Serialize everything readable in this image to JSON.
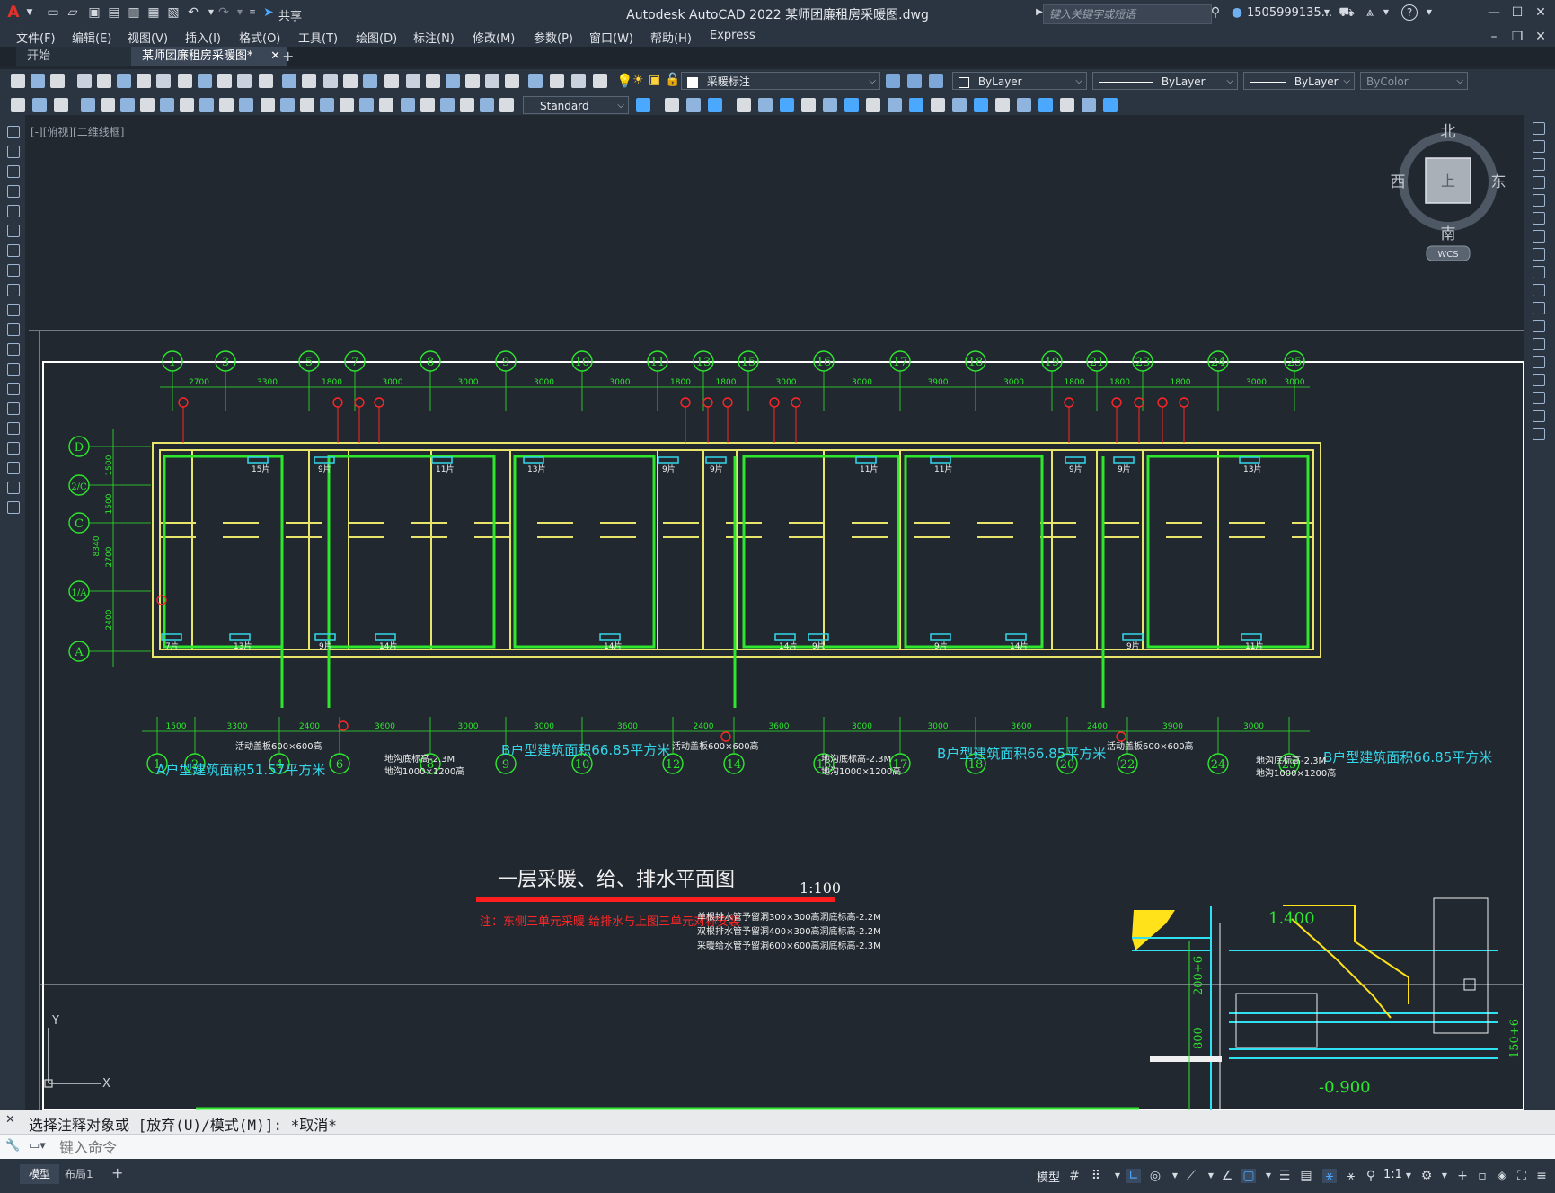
{
  "app": {
    "title": "Autodesk AutoCAD 2022    某师团廉租房采暖图.dwg",
    "logo": "A",
    "share_label": "共享",
    "search_placeholder": "键入关键字或短语",
    "user": "1505999135...",
    "help_icon": "?"
  },
  "menubar": [
    "文件(F)",
    "编辑(E)",
    "视图(V)",
    "插入(I)",
    "格式(O)",
    "工具(T)",
    "绘图(D)",
    "标注(N)",
    "修改(M)",
    "参数(P)",
    "窗口(W)",
    "帮助(H)",
    "Express"
  ],
  "tabs": [
    {
      "label": "开始",
      "active": false
    },
    {
      "label": "某师团廉租房采暖图*",
      "active": true
    }
  ],
  "tab_add": "+",
  "toolbar1": {
    "layer_name": "采暖标注",
    "color": "ByLayer",
    "linetype": "ByLayer",
    "lineweight": "ByLayer",
    "plotstyle": "ByColor"
  },
  "toolbar2": {
    "text_style": "Standard"
  },
  "viewport": {
    "label": "[-][俯视][二维线框]",
    "viewcube": {
      "north": "北",
      "south": "南",
      "east": "东",
      "west": "西",
      "top": "上"
    },
    "wcs": "WCS"
  },
  "drawing": {
    "grid_top": [
      "1",
      "3",
      "5",
      "7",
      "8",
      "9",
      "10",
      "11",
      "13",
      "15",
      "16",
      "17",
      "18",
      "19",
      "21",
      "23",
      "24",
      "25"
    ],
    "grid_bottom": [
      "1",
      "2",
      "4",
      "6",
      "8",
      "9",
      "10",
      "12",
      "14",
      "16",
      "17",
      "18",
      "20",
      "22",
      "24",
      "25"
    ],
    "grid_left": [
      "D",
      "2/C",
      "C",
      "1/A",
      "A"
    ],
    "dims_top": [
      "2700",
      "3300",
      "1800",
      "3000",
      "3000",
      "3000",
      "3000",
      "1800",
      "1800",
      "3000",
      "3000",
      "3900",
      "3000",
      "1800",
      "1800",
      "1800",
      "3000",
      "3000"
    ],
    "dims_bottom": [
      "1500",
      "3300",
      "2400",
      "3600",
      "3000",
      "3000",
      "3600",
      "2400",
      "3600",
      "3000",
      "3000",
      "3600",
      "2400",
      "3900",
      "3000"
    ],
    "dims_left": [
      "1500",
      "1500",
      "2700",
      "2400",
      "8340"
    ],
    "area_a": "A户型建筑面积51.57平方米",
    "area_b1": "B户型建筑面积66.85平方米",
    "area_b2": "B户型建筑面积66.85平方米",
    "area_b3": "B户型建筑面积66.85平方米",
    "radiators": [
      "15片",
      "9片",
      "11片",
      "13片",
      "9片",
      "9片",
      "11片",
      "11片",
      "9片",
      "9片",
      "13片",
      "7片",
      "13片",
      "9片",
      "14片",
      "14片",
      "14片",
      "9片",
      "9片",
      "14片",
      "9片",
      "11片"
    ],
    "notes_small": [
      "活动盖板600×600高",
      "地沟底标高-2.3M",
      "地沟1000×1200高"
    ],
    "plan_title": "一层采暖、给、排水平面图",
    "scale": "1:100",
    "red_note": "注：东侧三单元采暖 给排水与上图三单元对称安装",
    "white_notes": [
      "单根排水管予留洞300×300高洞底标高-2.2M",
      "双根排水管予留洞400×300高洞底标高-2.2M",
      "采暖给水管予留洞600×600高洞底标高-2.3M"
    ],
    "detail_labels": [
      "1.400",
      "-0.900",
      "200+6",
      "800",
      "150+6"
    ]
  },
  "command": {
    "history": "选择注释对象或 [放弃(U)/模式(M)]: *取消*",
    "placeholder": "键入命令"
  },
  "status": {
    "layout_tabs": [
      "模型",
      "布局1"
    ],
    "model_label": "模型",
    "scale": "1:1"
  }
}
